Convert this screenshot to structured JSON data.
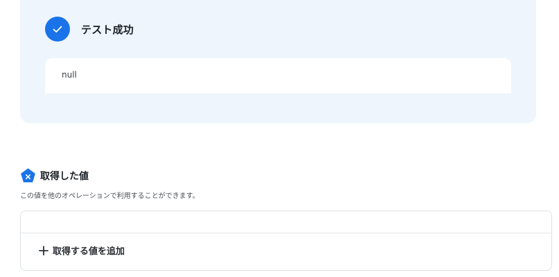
{
  "test_result": {
    "status_label": "テスト成功",
    "output_value": "null"
  },
  "retrieved_values": {
    "title": "取得した値",
    "description": "この値を他のオペレーションで利用することができます。",
    "add_button_label": "取得する値を追加"
  },
  "colors": {
    "accent": "#1a73e8",
    "card_background": "#eef5fd"
  },
  "icons": {
    "status": "check-icon",
    "section": "variable-pentagon-icon",
    "add": "plus-icon"
  }
}
